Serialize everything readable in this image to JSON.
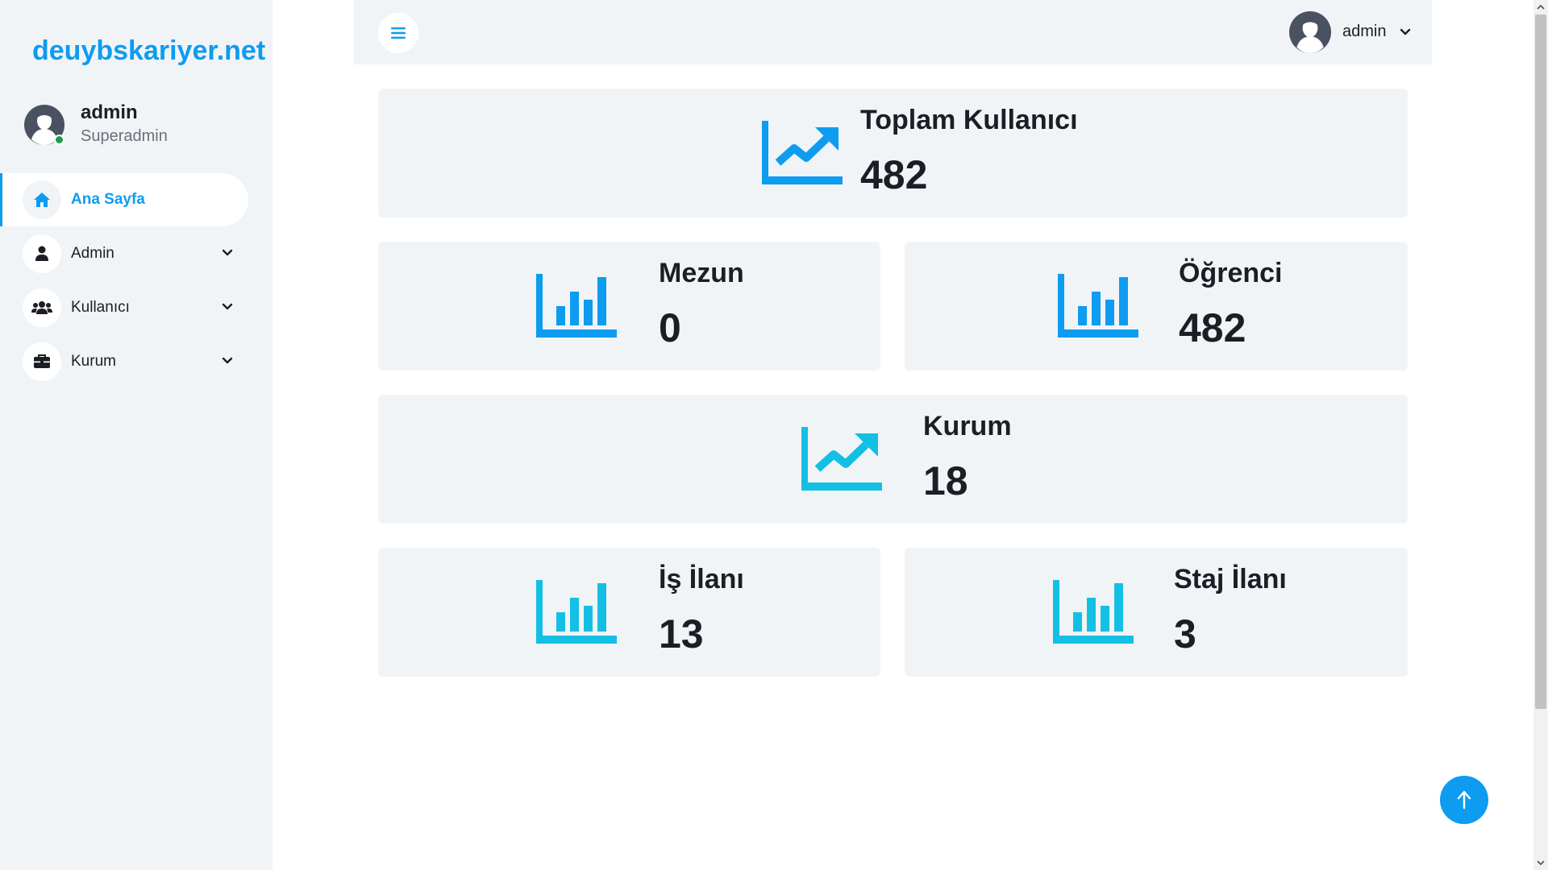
{
  "brand": {
    "name": "deuybskariyer.net",
    "color": "#0d9cf0"
  },
  "profile": {
    "name": "admin",
    "role": "Superadmin",
    "status": "online"
  },
  "sidebar": {
    "items": [
      {
        "label": "Ana Sayfa",
        "icon": "home-icon",
        "active": true,
        "expandable": false
      },
      {
        "label": "Admin",
        "icon": "user-icon",
        "active": false,
        "expandable": true
      },
      {
        "label": "Kullanıcı",
        "icon": "users-icon",
        "active": false,
        "expandable": true
      },
      {
        "label": "Kurum",
        "icon": "briefcase-icon",
        "active": false,
        "expandable": true
      }
    ]
  },
  "topbar": {
    "menu_icon": "hamburger-icon",
    "user": {
      "name": "admin",
      "icon": "chevron-down-icon"
    }
  },
  "stats": {
    "total_users": {
      "title": "Toplam Kullanıcı",
      "value": "482",
      "icon": "trending-chart-icon",
      "color": "#0d9cf0"
    },
    "graduates": {
      "title": "Mezun",
      "value": "0",
      "icon": "bar-chart-icon",
      "color": "#0d9cf0"
    },
    "students": {
      "title": "Öğrenci",
      "value": "482",
      "icon": "bar-chart-icon",
      "color": "#0d9cf0"
    },
    "institutions": {
      "title": "Kurum",
      "value": "18",
      "icon": "trending-chart-icon",
      "color": "#14bfe4"
    },
    "job_postings": {
      "title": "İş İlanı",
      "value": "13",
      "icon": "bar-chart-icon",
      "color": "#14bfe4"
    },
    "internship_postings": {
      "title": "Staj İlanı",
      "value": "3",
      "icon": "bar-chart-icon",
      "color": "#14bfe4"
    }
  },
  "back_to_top": {
    "icon": "arrow-up-icon"
  }
}
